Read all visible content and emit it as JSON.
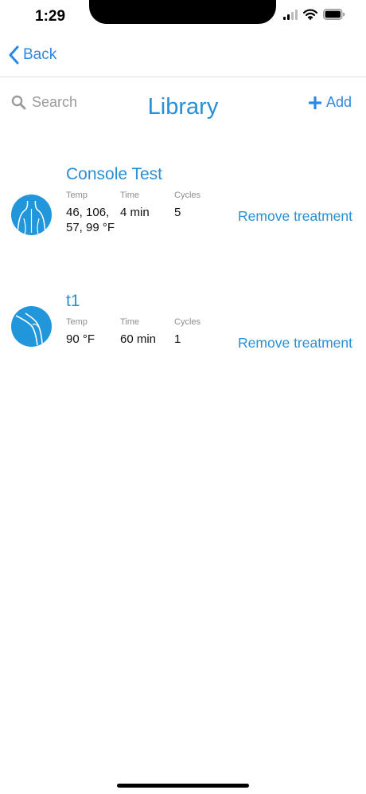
{
  "status_bar": {
    "time": "1:29"
  },
  "nav": {
    "back_label": "Back"
  },
  "header": {
    "search_placeholder": "Search",
    "title": "Library",
    "add_label": "Add"
  },
  "columns": {
    "temp": "Temp",
    "time": "Time",
    "cycles": "Cycles"
  },
  "treatments": [
    {
      "name": "Console Test",
      "icon": "back-torso-icon",
      "temp": "46, 106, 57, 99 °F",
      "time": "4 min",
      "cycles": "5",
      "remove_label": "Remove treatment"
    },
    {
      "name": "t1",
      "icon": "knee-icon",
      "temp": "90 °F",
      "time": "60 min",
      "cycles": "1",
      "remove_label": "Remove treatment"
    }
  ],
  "colors": {
    "accent": "#2a8fd4",
    "link": "#2a89e6",
    "icon_bg": "#2196da"
  }
}
